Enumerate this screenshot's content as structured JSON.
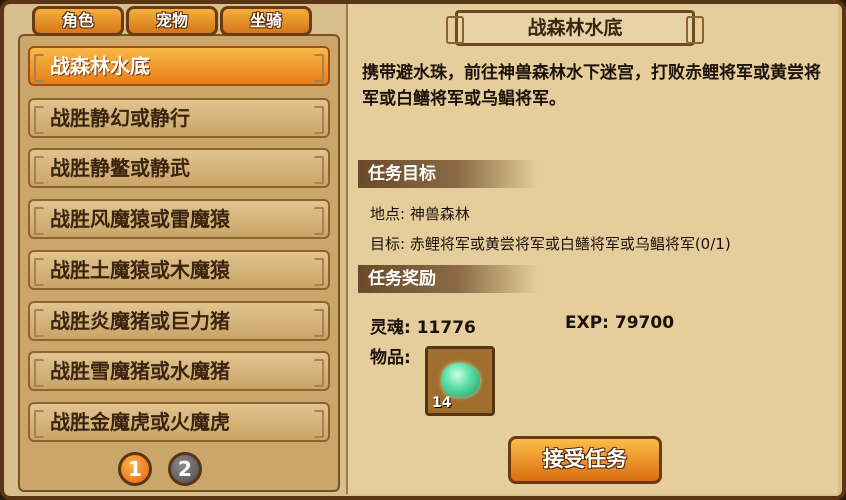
{
  "tabs": [
    "角色",
    "宠物",
    "坐骑"
  ],
  "quests": [
    "战森林水底",
    "战胜静幻或静行",
    "战胜静鳖或静武",
    "战胜风魔猿或雷魔猿",
    "战胜土魔猿或木魔猿",
    "战胜炎魔猪或巨力猪",
    "战胜雪魔猪或水魔猪",
    "战胜金魔虎或火魔虎"
  ],
  "pager": [
    "1",
    "2"
  ],
  "detail": {
    "title": "战森林水底",
    "description": "携带避水珠，前往神兽森林水下迷宫，打败赤鲤将军或黄尝将军或白鳝将军或乌鲳将军。",
    "goal_header": "任务目标",
    "location": "地点: 神兽森林",
    "target": "目标: 赤鲤将军或黄尝将军或白鳝将军或乌鲳将军(0/1)",
    "reward_header": "任务奖励",
    "soul": "灵魂: 11776",
    "exp": "EXP: 79700",
    "items_label": "物品:",
    "item_count": "14"
  },
  "accept_button": "接受任务",
  "colors": {
    "accent_orange": "#e67e16",
    "panel_bg": "#e5cd9c",
    "frame_brown": "#5a3514"
  }
}
